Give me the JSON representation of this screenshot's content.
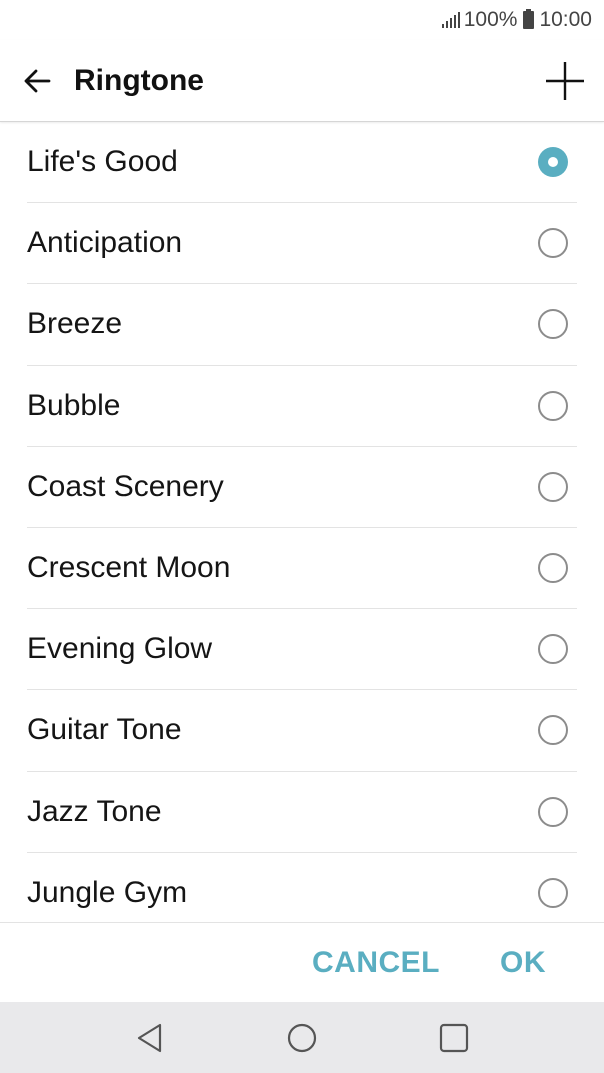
{
  "status_bar": {
    "battery": "100%",
    "time": "10:00"
  },
  "app_bar": {
    "title": "Ringtone"
  },
  "ringtones": [
    {
      "label": "Life's Good",
      "selected": true
    },
    {
      "label": "Anticipation",
      "selected": false
    },
    {
      "label": "Breeze",
      "selected": false
    },
    {
      "label": "Bubble",
      "selected": false
    },
    {
      "label": "Coast Scenery",
      "selected": false
    },
    {
      "label": "Crescent Moon",
      "selected": false
    },
    {
      "label": "Evening Glow",
      "selected": false
    },
    {
      "label": "Guitar Tone",
      "selected": false
    },
    {
      "label": "Jazz Tone",
      "selected": false
    },
    {
      "label": "Jungle Gym",
      "selected": false
    }
  ],
  "actions": {
    "cancel": "CANCEL",
    "ok": "OK"
  },
  "colors": {
    "accent": "#5aaec1",
    "nav_bar": "#e9e9eb"
  }
}
